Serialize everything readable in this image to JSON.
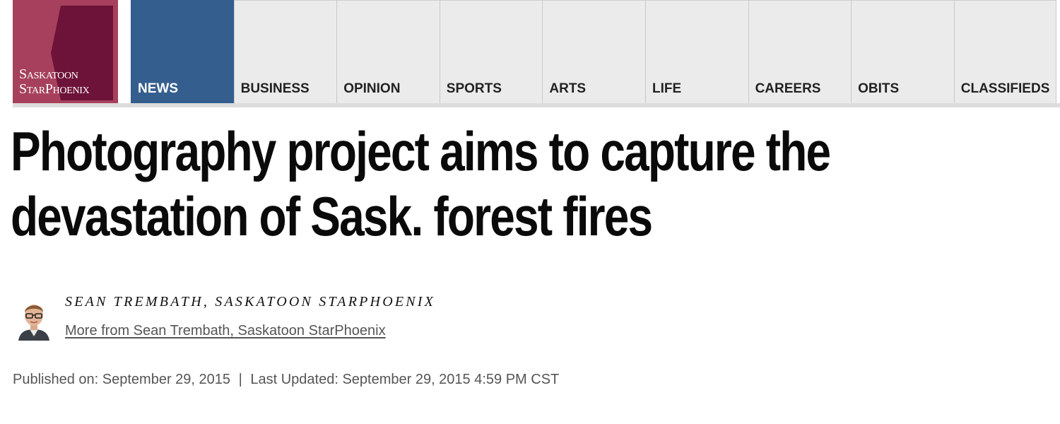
{
  "logo": {
    "line1": "Saskatoon",
    "line2": "StarPhoenix",
    "colors": {
      "background": "#a7405c",
      "mark": "#6d1238"
    }
  },
  "nav": {
    "items": [
      {
        "label": "NEWS",
        "active": true
      },
      {
        "label": "BUSINESS",
        "active": false
      },
      {
        "label": "OPINION",
        "active": false
      },
      {
        "label": "SPORTS",
        "active": false
      },
      {
        "label": "ARTS",
        "active": false
      },
      {
        "label": "LIFE",
        "active": false
      },
      {
        "label": "CAREERS",
        "active": false
      },
      {
        "label": "OBITS",
        "active": false
      },
      {
        "label": "CLASSIFIEDS",
        "active": false
      }
    ],
    "colors": {
      "active_bg": "#345e8e",
      "inactive_bg": "#ebebeb"
    }
  },
  "article": {
    "headline": "Photography project aims to capture the devastation of Sask. forest fires",
    "byline": {
      "author": "SEAN TREMBATH, SASKATOON STARPHOENIX",
      "more_link": "More from Sean Trembath, Saskatoon StarPhoenix",
      "avatar_icon": "author-avatar"
    },
    "published_label": "Published on:",
    "published_date": "September 29, 2015",
    "separator": "|",
    "updated_label": "Last Updated:",
    "updated_date": "September 29, 2015 4:59 PM CST"
  }
}
